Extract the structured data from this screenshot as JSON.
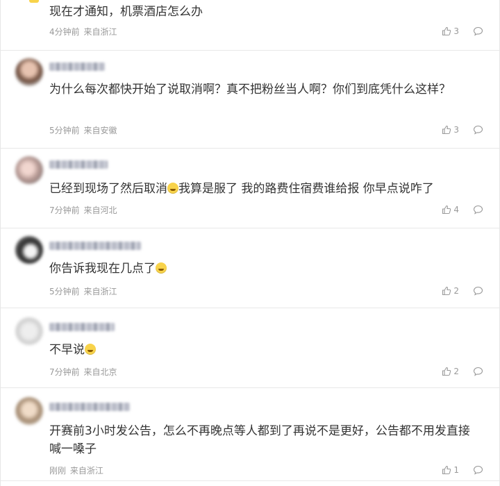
{
  "comments": [
    {
      "text": "现在才通知，机票酒店怎么办",
      "emoji": false,
      "time": "4分钟前",
      "source": "来自浙江",
      "likes": "3"
    },
    {
      "text": "为什么每次都快开始了说取消啊？真不把粉丝当人啊？你们到底凭什么这样？",
      "emoji": false,
      "time": "5分钟前",
      "source": "来自安徽",
      "likes": "3"
    },
    {
      "text_before": "已经到现场了然后取消",
      "text_after": "我算是服了 我的路费住宿费谁给报 你早点说咋了",
      "emoji": true,
      "time": "7分钟前",
      "source": "来自河北",
      "likes": "4"
    },
    {
      "text_before": "你告诉我现在几点了",
      "text_after": "",
      "emoji": true,
      "time": "5分钟前",
      "source": "来自浙江",
      "likes": "2"
    },
    {
      "text_before": "不早说",
      "text_after": "",
      "emoji": true,
      "time": "7分钟前",
      "source": "来自北京",
      "likes": "2"
    },
    {
      "text": "开赛前3小时发公告，怎么不再晚点等人都到了再说不是更好，公告都不用发直接喊一嗓子",
      "emoji": false,
      "time": "刚刚",
      "source": "来自浙江",
      "likes": "1"
    }
  ],
  "icons": {
    "like": "thumbs-up-icon",
    "reply": "comment-bubble-icon"
  },
  "colors": {
    "text": "#333333",
    "meta": "#999999",
    "divider": "#e8e8e8",
    "emoji": "#f8d34b"
  }
}
